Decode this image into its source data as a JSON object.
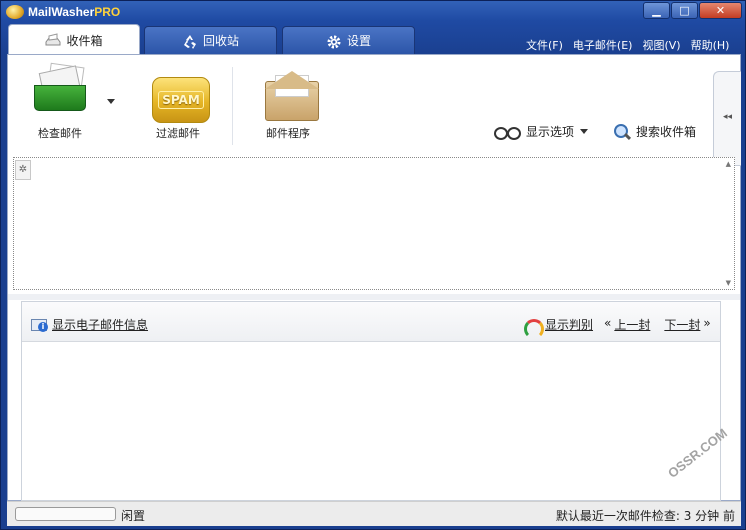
{
  "window": {
    "title_main": "MailWasher",
    "title_suffix": "PRO",
    "buttons": {
      "minimize": "▁",
      "maximize": "□",
      "close": "✕"
    }
  },
  "tabs": [
    {
      "label": "收件箱",
      "icon": "inbox-icon",
      "active": true
    },
    {
      "label": "回收站",
      "icon": "recycle-icon",
      "active": false
    },
    {
      "label": "设置",
      "icon": "gear-icon",
      "active": false
    }
  ],
  "menu": [
    "文件(F)",
    "电子邮件(E)",
    "视图(V)",
    "帮助(H)"
  ],
  "toolbar": {
    "check_mail": "检查邮件",
    "filter_mail": "过滤邮件",
    "spam_text": "SPAM",
    "mail_program": "邮件程序",
    "display_options": "显示选项",
    "search_inbox": "搜索收件箱",
    "collapse_arrow": "◂◂"
  },
  "message_list": {
    "corner_symbol": "✲",
    "scroll_up": "▲",
    "scroll_down": "▼"
  },
  "preview": {
    "show_info": "显示电子邮件信息",
    "show_judgment": "显示判别",
    "prev_prefix": "«",
    "prev": "上一封",
    "next": "下一封",
    "next_suffix": "»"
  },
  "status": {
    "progress": 0,
    "idle": "闲置",
    "last_check": "默认最近一次邮件检查: 3 分钟 前"
  },
  "watermark": "OSSR.COM"
}
